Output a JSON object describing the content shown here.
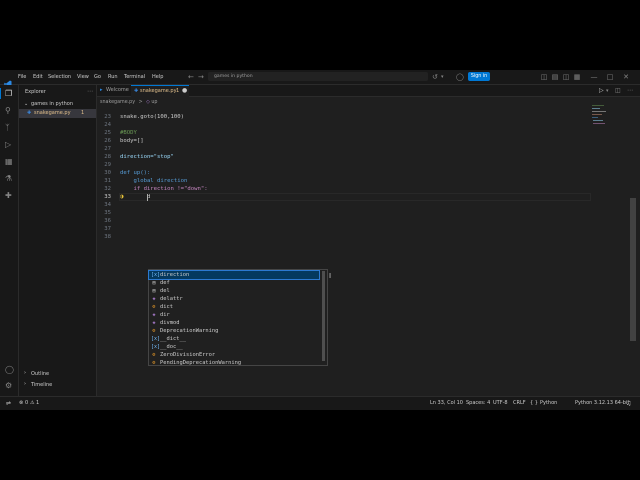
{
  "menu": [
    "File",
    "Edit",
    "Selection",
    "View",
    "Go",
    "Run",
    "Terminal",
    "Help"
  ],
  "search": {
    "placeholder": "games in python"
  },
  "signin_label": "Sign in",
  "explorer": {
    "title": "Explorer",
    "folder": "games in python",
    "file": "snakegame.py",
    "file_badge": "1"
  },
  "panels": {
    "outline": "Outline",
    "timeline": "Timeline"
  },
  "tabs": [
    {
      "label": "Welcome"
    },
    {
      "label": "snakegame.py",
      "badge": "1"
    }
  ],
  "breadcrumb": {
    "file": "snakegame.py",
    "separator": ">",
    "symbol": "up"
  },
  "code_lines": [
    {
      "n": "23",
      "text": "snake.goto(100,100)"
    },
    {
      "n": "24",
      "text": ""
    },
    {
      "n": "25",
      "text": "#BODY"
    },
    {
      "n": "26",
      "text": "body=[]"
    },
    {
      "n": "27",
      "text": ""
    },
    {
      "n": "28",
      "text": "direction=\"stop\""
    },
    {
      "n": "29",
      "text": ""
    },
    {
      "n": "30",
      "text": "def up():"
    },
    {
      "n": "31",
      "text": "    global direction"
    },
    {
      "n": "32",
      "text": "    if direction !=\"down\":"
    },
    {
      "n": "33",
      "text": "        d"
    },
    {
      "n": "34",
      "text": ""
    },
    {
      "n": "35",
      "text": ""
    },
    {
      "n": "36",
      "text": ""
    },
    {
      "n": "37",
      "text": ""
    },
    {
      "n": "38",
      "text": ""
    }
  ],
  "suggestions": [
    {
      "label": "direction",
      "kind": "variable"
    },
    {
      "label": "def",
      "kind": "keyword"
    },
    {
      "label": "del",
      "kind": "keyword"
    },
    {
      "label": "delattr",
      "kind": "function"
    },
    {
      "label": "dict",
      "kind": "class"
    },
    {
      "label": "dir",
      "kind": "function"
    },
    {
      "label": "divmod",
      "kind": "function"
    },
    {
      "label": "DeprecationWarning",
      "kind": "class"
    },
    {
      "label": "__dict__",
      "kind": "variable"
    },
    {
      "label": "__doc__",
      "kind": "variable"
    },
    {
      "label": "ZeroDivisionError",
      "kind": "class"
    },
    {
      "label": "PendingDeprecationWarning",
      "kind": "class"
    }
  ],
  "status": {
    "errors": "0",
    "warnings": "1",
    "position": "Ln 33, Col 10",
    "spaces": "Spaces: 4",
    "encoding": "UTF-8",
    "eol": "CRLF",
    "braces": "{ }",
    "language": "Python",
    "interpreter": "Python 3.12.13 64-bit"
  },
  "colors": {
    "accent": "#0078d4",
    "keyword": "#569cd6",
    "string": "#ce9178",
    "function": "#dcdcaa",
    "variable": "#9cdcfe"
  }
}
